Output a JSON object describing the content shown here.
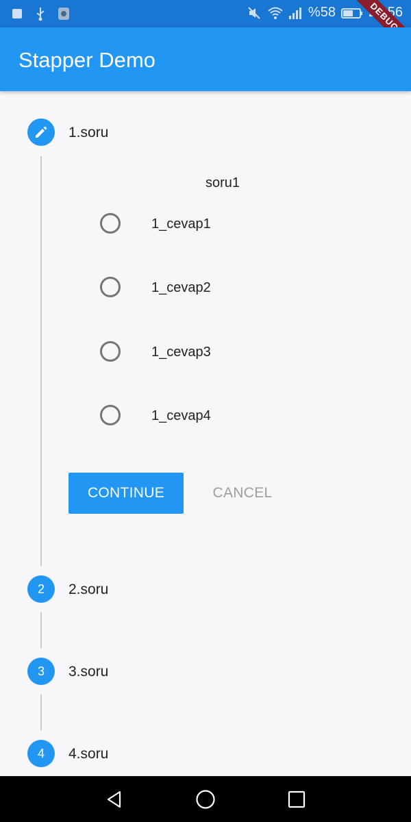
{
  "status_bar": {
    "battery_percent": "%58",
    "time": "20:56",
    "icons": [
      "notification-icon",
      "usb-icon",
      "debug-app-icon",
      "mute-icon",
      "wifi-icon",
      "signal-icon",
      "battery-icon"
    ]
  },
  "debug_banner": "DEBUG",
  "app_bar": {
    "title": "Stapper Demo"
  },
  "stepper": {
    "steps": [
      {
        "number": "1",
        "title": "1.soru",
        "state": "editing",
        "icon": "pencil-icon"
      },
      {
        "number": "2",
        "title": "2.soru"
      },
      {
        "number": "3",
        "title": "3.soru"
      },
      {
        "number": "4",
        "title": "4.soru"
      }
    ],
    "active_content": {
      "question": "soru1",
      "options": [
        "1_cevap1",
        "1_cevap2",
        "1_cevap3",
        "1_cevap4"
      ]
    },
    "continue_label": "CONTINUE",
    "cancel_label": "CANCEL"
  },
  "colors": {
    "primary": "#2196f3",
    "status_bar": "#1976d2",
    "debug_ribbon": "#8b1e2d"
  },
  "nav_bar": {
    "icons": [
      "back-icon",
      "home-icon",
      "recents-icon"
    ]
  }
}
